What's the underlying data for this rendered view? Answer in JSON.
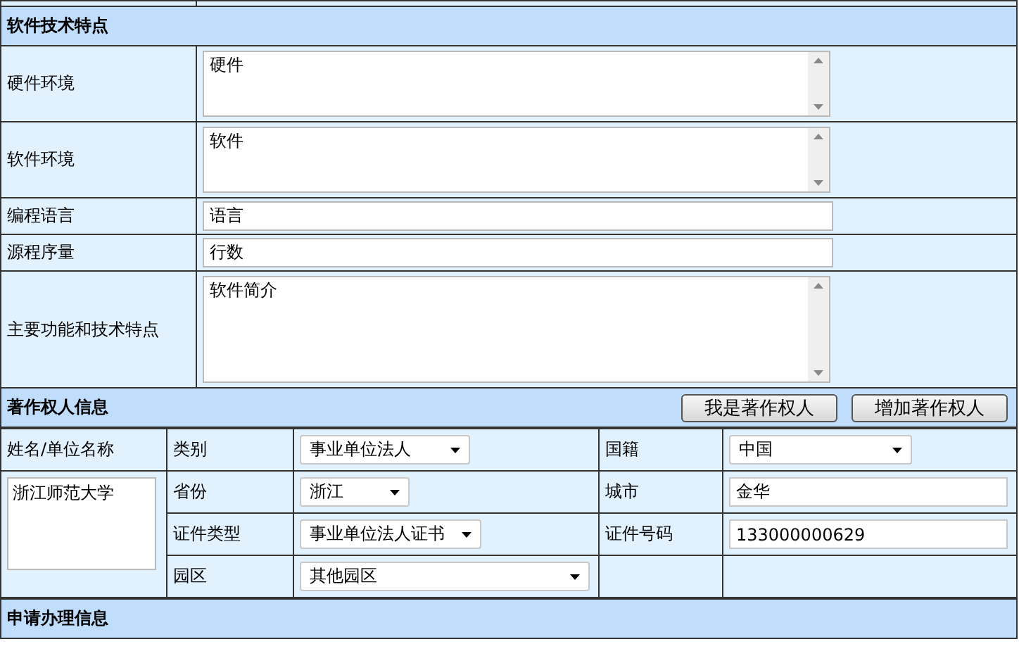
{
  "tech_section": {
    "title": "软件技术特点",
    "rows": [
      {
        "label": "硬件环境",
        "kind": "textarea",
        "value": "硬件"
      },
      {
        "label": "软件环境",
        "kind": "textarea",
        "value": "软件"
      },
      {
        "label": "编程语言",
        "kind": "input",
        "value": "语言"
      },
      {
        "label": "源程序量",
        "kind": "input",
        "value": "行数"
      },
      {
        "label": "主要功能和技术特点",
        "kind": "bigtextarea",
        "value": "软件简介"
      }
    ]
  },
  "owner_section": {
    "title": "著作权人信息",
    "buttons": [
      "我是著作权人",
      "增加著作权人"
    ],
    "name_label": "姓名/单位名称",
    "name_value": "浙江师范大学",
    "rows": [
      [
        {
          "label": "类别",
          "kind": "select",
          "value": "事业单位法人"
        },
        {
          "label": "国籍",
          "kind": "select",
          "value": "中国"
        }
      ],
      [
        {
          "label": "省份",
          "kind": "select",
          "value": "浙江"
        },
        {
          "label": "城市",
          "kind": "input",
          "value": "金华"
        }
      ],
      [
        {
          "label": "证件类型",
          "kind": "select",
          "value": "事业单位法人证书"
        },
        {
          "label": "证件号码",
          "kind": "input",
          "value": "133000000629"
        }
      ],
      [
        {
          "label": "园区",
          "kind": "select",
          "value": "其他园区"
        }
      ]
    ]
  },
  "apply_section": {
    "title": "申请办理信息"
  }
}
